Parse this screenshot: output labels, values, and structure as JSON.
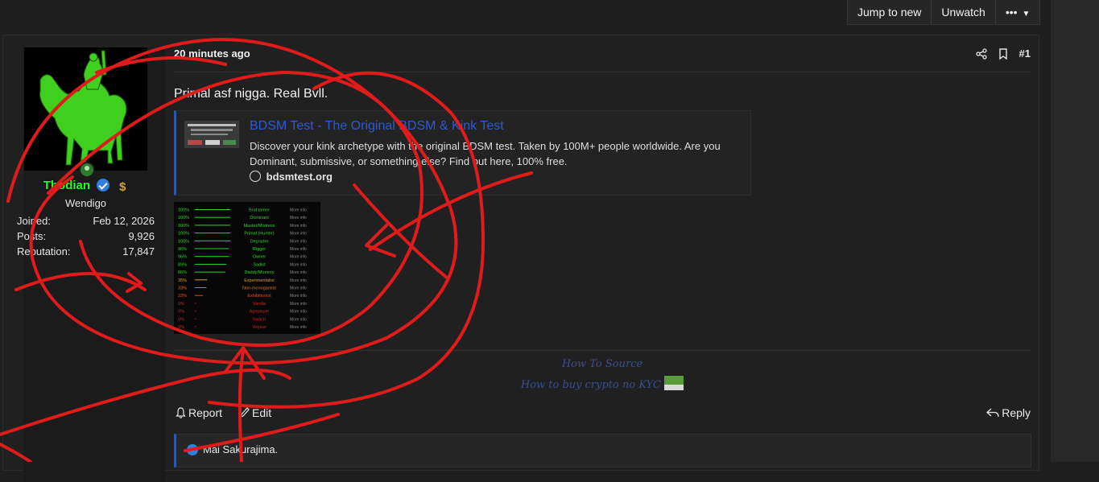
{
  "topbar": {
    "jump_to_new": "Jump to new",
    "unwatch": "Unwatch",
    "more": "•••"
  },
  "user": {
    "name": "Thodian",
    "title": "Wendigo",
    "stats": [
      {
        "label": "Joined:",
        "value": "Feb 12, 2026"
      },
      {
        "label": "Posts:",
        "value": "9,926"
      },
      {
        "label": "Reputation:",
        "value": "17,847"
      }
    ]
  },
  "post": {
    "date": "20 minutes ago",
    "number": "#1",
    "body": "Primal asf nigga. Real Bvll.",
    "embed": {
      "title": "BDSM Test - The Original BDSM & Kink Test",
      "description": "Discover your kink archetype with the original BDSM test. Taken by 100M+ people worldwide. Are you Dominant, submissive, or something else? Find out here, 100% free.",
      "site": "bdsmtest.org"
    },
    "results": [
      {
        "pct": "100%",
        "label": "Brat tamer",
        "more": "More info",
        "color": "#2ed12e"
      },
      {
        "pct": "100%",
        "label": "Dominant",
        "more": "More info",
        "color": "#2ed12e"
      },
      {
        "pct": "100%",
        "label": "Master/Mistress",
        "more": "More info",
        "color": "#2ed12e"
      },
      {
        "pct": "100%",
        "label": "Primal (Hunter)",
        "more": "More info",
        "color": "#2ed12e"
      },
      {
        "pct": "100%",
        "label": "Degrader",
        "more": "More info",
        "color": "#2ed12e"
      },
      {
        "pct": "96%",
        "label": "Rigger",
        "more": "More info",
        "color": "#2ed12e"
      },
      {
        "pct": "96%",
        "label": "Owner",
        "more": "More info",
        "color": "#2ed12e"
      },
      {
        "pct": "89%",
        "label": "Sadist",
        "more": "More info",
        "color": "#2ed12e"
      },
      {
        "pct": "86%",
        "label": "Daddy/Mommy",
        "more": "More info",
        "color": "#2ed12e"
      },
      {
        "pct": "35%",
        "label": "Experimentalist",
        "more": "More info",
        "color": "#d9a21e"
      },
      {
        "pct": "33%",
        "label": "Non-monogamist",
        "more": "More info",
        "color": "#d9731e"
      },
      {
        "pct": "23%",
        "label": "Exhibitionist",
        "more": "More info",
        "color": "#d9531e"
      },
      {
        "pct": "0%",
        "label": "Vanilla",
        "more": "More info",
        "color": "#cc2222"
      },
      {
        "pct": "0%",
        "label": "Ageplayer",
        "more": "More info",
        "color": "#cc2222"
      },
      {
        "pct": "0%",
        "label": "Switch",
        "more": "More info",
        "color": "#cc2222"
      },
      {
        "pct": "0%",
        "label": "Voyeur",
        "more": "More info",
        "color": "#cc2222"
      }
    ],
    "signature": {
      "line1": "How To Source",
      "line2": "How to buy crypto no KYC"
    },
    "actions": {
      "report": "Report",
      "edit": "Edit",
      "reply": "Reply"
    },
    "reactions": {
      "text": "Mai Sakurajima."
    }
  },
  "colors": {
    "background": "#1f1f1f",
    "username": "#22ff22",
    "link": "#2b5ad6",
    "accent": "#2f57a6",
    "annotation": "#e01b1b"
  }
}
